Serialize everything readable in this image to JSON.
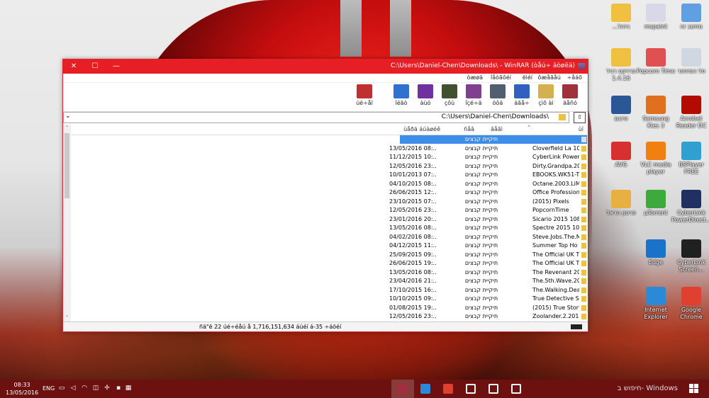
{
  "window": {
    "title": "C:\\Users\\Daniel-Chen\\Downloads\\ - WinRAR (òåú÷ äòøëä)",
    "controls": {
      "close": "✕",
      "maximize": "☐",
      "minimize": "—"
    },
    "menu": [
      "÷åáõ",
      "ôæåãåú",
      "ëìéí",
      "îåòãôéí",
      "òæøä"
    ],
    "toolbar": [
      {
        "label": "äåñó",
        "icon": "add-archive-icon",
        "color": "#a0303a"
      },
      {
        "label": "çìõ àì",
        "icon": "extract-to-icon",
        "color": "#d4b050"
      },
      {
        "label": "áãå÷",
        "icon": "test-icon",
        "color": "#3060c0"
      },
      {
        "label": "öôä",
        "icon": "view-icon",
        "color": "#506070"
      },
      {
        "label": "îçé÷ä",
        "icon": "delete-icon",
        "color": "#804090"
      },
      {
        "label": "çôù",
        "icon": "find-icon",
        "color": "#405030"
      },
      {
        "label": "àùó",
        "icon": "wizard-icon",
        "color": "#7030a0"
      },
      {
        "label": "îéãò",
        "icon": "info-icon",
        "color": "#3070d0"
      },
      {
        "label": "úé÷åï",
        "icon": "repair-icon",
        "color": "#c03030"
      }
    ],
    "address": "C:\\Users\\Daniel-Chen\\Downloads\\",
    "columns": {
      "name": "ùí",
      "size": "âåãì",
      "type": "ñåâ",
      "modified": "ùåðä áúàøéê"
    },
    "selected_row": "תיקיית קבצים",
    "rows": [
      {
        "name": "Cloverfield La 10",
        "type": "תיקיית קבצים",
        "modified": "13/05/2016 08:.."
      },
      {
        "name": "CyberLink Power",
        "type": "תיקיית קבצים",
        "modified": "11/12/2015 10:.."
      },
      {
        "name": "Dirty.Grandpa.20",
        "type": "תיקיית קבצים",
        "modified": "12/05/2016 23:.."
      },
      {
        "name": "EBOOKS.WK51-TL",
        "type": "תיקיית קבצים",
        "modified": "10/01/2013 07:.."
      },
      {
        "name": "Octane.2003.LiMi",
        "type": "תיקיית קבצים",
        "modified": "04/10/2015 08:.."
      },
      {
        "name": "Office Profession",
        "type": "תיקיית קבצים",
        "modified": "26/06/2015 12:.."
      },
      {
        "name": "(2015) Pixels",
        "type": "תיקיית קבצים",
        "modified": "23/10/2015 07:.."
      },
      {
        "name": "PopcornTime",
        "type": "תיקיית קבצים",
        "modified": "12/05/2016 23:.."
      },
      {
        "name": "Sicario 2015 108",
        "type": "תיקיית קבצים",
        "modified": "23/01/2016 20:.."
      },
      {
        "name": "Spectre 2015 10",
        "type": "תיקיית קבצים",
        "modified": "13/05/2016 08:.."
      },
      {
        "name": "Steve.Jobs.The.M",
        "type": "תיקיית קבצים",
        "modified": "04/02/2016 08:.."
      },
      {
        "name": "Summer Top Ho",
        "type": "תיקיית קבצים",
        "modified": "04/12/2015 11:.."
      },
      {
        "name": "The Official UK T",
        "type": "תיקיית קבצים",
        "modified": "25/09/2015 09:.."
      },
      {
        "name": "The Official UK T",
        "type": "תיקיית קבצים",
        "modified": "26/06/2015 19:.."
      },
      {
        "name": "The Revenant 20",
        "type": "תיקיית קבצים",
        "modified": "13/05/2016 08:.."
      },
      {
        "name": "The.5th.Wave.20",
        "type": "תיקיית קבצים",
        "modified": "23/04/2016 21:.."
      },
      {
        "name": "The.Walking.Dea",
        "type": "תיקיית קבצים",
        "modified": "17/10/2015 16:.."
      },
      {
        "name": "True Detective S",
        "type": "תיקיית קבצים",
        "modified": "10/10/2015 09:.."
      },
      {
        "name": "(2015) True Story",
        "type": "תיקיית קבצים",
        "modified": "01/08/2015 19:.."
      },
      {
        "name": "Zoolander.2.201",
        "type": "תיקיית קבצים",
        "modified": "12/05/2016 23:.."
      }
    ],
    "status": "ñä\"ë 22 úé÷éåú å 1,716,151,634 áúéí á-35 ÷áöéí"
  },
  "desktop": [
    {
      "label": "...ניהול",
      "icon": "folder-download-icon",
      "color": "#f0c040"
    },
    {
      "label": "mspaint",
      "icon": "paint-icon",
      "color": "#d8d8e8"
    },
    {
      "label": "מחשב זה",
      "icon": "computer-icon",
      "color": "#60a0e0"
    },
    {
      "label": "פרויקט רגיל 1.4.16",
      "icon": "folder-icon",
      "color": "#f0c040"
    },
    {
      "label": "Popcorn Time",
      "icon": "popcorn-icon",
      "color": "#e05050"
    },
    {
      "label": "סל המיחזור",
      "icon": "recycle-bin-icon",
      "color": "#cfd8e0"
    },
    {
      "label": "סיכום",
      "icon": "word-doc-icon",
      "color": "#2b5797"
    },
    {
      "label": "Samsung Kies 3",
      "icon": "kies-icon",
      "color": "#e07020"
    },
    {
      "label": "Acrobat Reader DC",
      "icon": "acrobat-icon",
      "color": "#b30b00"
    },
    {
      "label": "AVG",
      "icon": "avg-icon",
      "color": "#d83030"
    },
    {
      "label": "VLC media player",
      "icon": "vlc-icon",
      "color": "#f08010"
    },
    {
      "label": "BSPlayer FREE",
      "icon": "bsplayer-icon",
      "color": "#30a0d0"
    },
    {
      "label": "סרטון הראל",
      "icon": "folder-video-icon",
      "color": "#e8b040"
    },
    {
      "label": "µTorrent",
      "icon": "utorrent-icon",
      "color": "#3caa3c"
    },
    {
      "label": "CyberLink PowerDirect...",
      "icon": "powerdirector-icon",
      "color": "#203060"
    },
    {
      "label": "Edge",
      "icon": "edge-icon",
      "color": "#1a73c8"
    },
    {
      "label": "CyberLink Screen...",
      "icon": "screen-recorder-icon",
      "color": "#202020"
    },
    {
      "label": "Internet Explorer",
      "icon": "ie-icon",
      "color": "#2a8ad8"
    },
    {
      "label": "Google Chrome",
      "icon": "chrome-icon",
      "color": "#e04030"
    }
  ],
  "taskbar": {
    "time": "08:33",
    "date": "13/05/2016",
    "lang": "ENG",
    "search": "חיפוש ב- Windows",
    "apps": [
      {
        "icon": "winrar-icon",
        "color": "#a03040"
      },
      {
        "icon": "edge-icon",
        "color": "#2a8ad8"
      },
      {
        "icon": "chrome-icon",
        "color": "#e04030"
      },
      {
        "icon": "settings-icon",
        "color": "#ffffff"
      },
      {
        "icon": "store-icon",
        "color": "#ffffff"
      },
      {
        "icon": "task-view-icon",
        "color": "#ffffff"
      }
    ]
  }
}
